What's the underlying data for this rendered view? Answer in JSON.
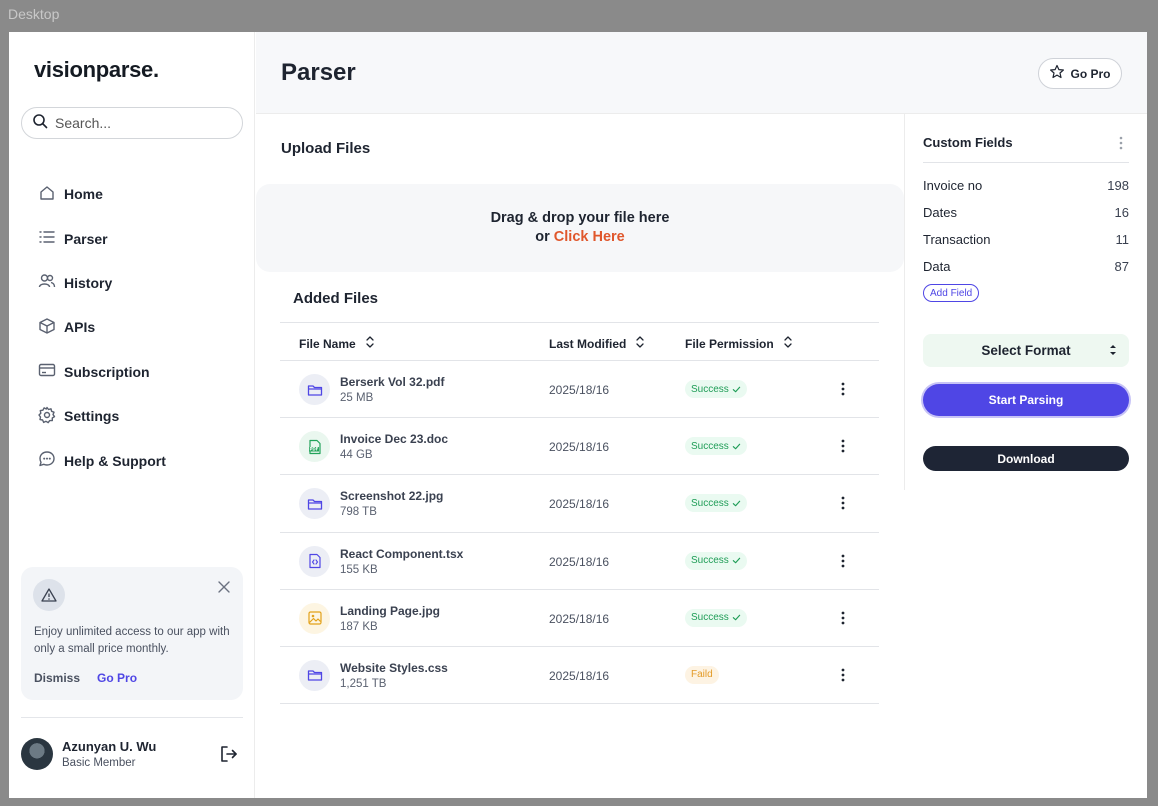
{
  "desktop_label": "Desktop",
  "app": {
    "logo": "visionparse."
  },
  "search": {
    "placeholder": "Search..."
  },
  "nav": [
    {
      "label": "Home",
      "icon": "home-icon"
    },
    {
      "label": "Parser",
      "icon": "list-icon"
    },
    {
      "label": "History",
      "icon": "users-icon"
    },
    {
      "label": "APIs",
      "icon": "cube-icon"
    },
    {
      "label": "Subscription",
      "icon": "card-icon"
    },
    {
      "label": "Settings",
      "icon": "gear-icon"
    },
    {
      "label": "Help & Support",
      "icon": "chat-icon"
    }
  ],
  "promo": {
    "text": "Enjoy unlimited access to our app with only a small price monthly.",
    "dismiss": "Dismiss",
    "go_pro": "Go Pro"
  },
  "user": {
    "name": "Azunyan U. Wu",
    "role": "Basic Member"
  },
  "header": {
    "title": "Parser",
    "go_pro": "Go Pro"
  },
  "upload": {
    "title": "Upload Files",
    "drop_text": "Drag & drop your file here",
    "or": "or ",
    "click_here": "Click Here"
  },
  "files": {
    "title": "Added Files",
    "columns": [
      "File Name",
      "Last Modified",
      "File Permission"
    ],
    "rows": [
      {
        "name": "Berserk Vol 32.pdf",
        "size": "25 MB",
        "date": "2025/18/16",
        "status": "Success",
        "icon": "folder-icon",
        "icon_color": "#4f46e5",
        "icon_bg": "#eceef5"
      },
      {
        "name": "Invoice Dec 23.doc",
        "size": "44 GB",
        "date": "2025/18/16",
        "status": "Success",
        "icon": "pdf-icon",
        "icon_color": "#22a35a",
        "icon_bg": "#eaf7ef"
      },
      {
        "name": "Screenshot 22.jpg",
        "size": "798 TB",
        "date": "2025/18/16",
        "status": "Success",
        "icon": "folder-icon",
        "icon_color": "#4f46e5",
        "icon_bg": "#eceef5"
      },
      {
        "name": "React Component.tsx",
        "size": "155 KB",
        "date": "2025/18/16",
        "status": "Success",
        "icon": "code-file-icon",
        "icon_color": "#4f46e5",
        "icon_bg": "#eceef5"
      },
      {
        "name": "Landing Page.jpg",
        "size": "187 KB",
        "date": "2025/18/16",
        "status": "Success",
        "icon": "image-icon",
        "icon_color": "#e3a21a",
        "icon_bg": "#fdf5e2"
      },
      {
        "name": "Website Styles.css",
        "size": "1,251 TB",
        "date": "2025/18/16",
        "status": "Faild",
        "icon": "folder-icon",
        "icon_color": "#4f46e5",
        "icon_bg": "#eceef5"
      }
    ]
  },
  "custom_fields": {
    "title": "Custom Fields",
    "items": [
      {
        "label": "Invoice no",
        "value": "198"
      },
      {
        "label": "Dates",
        "value": "16"
      },
      {
        "label": "Transaction",
        "value": "11"
      },
      {
        "label": "Data",
        "value": "87"
      }
    ],
    "add_field": "Add Field"
  },
  "actions": {
    "select_format": "Select Format",
    "start_parsing": "Start Parsing",
    "download": "Download"
  },
  "colors": {
    "accent": "#4f46e5",
    "success": "#1f9d57",
    "failed": "#e39b28",
    "link": "#e0572c",
    "dark_button": "#1e2535"
  }
}
